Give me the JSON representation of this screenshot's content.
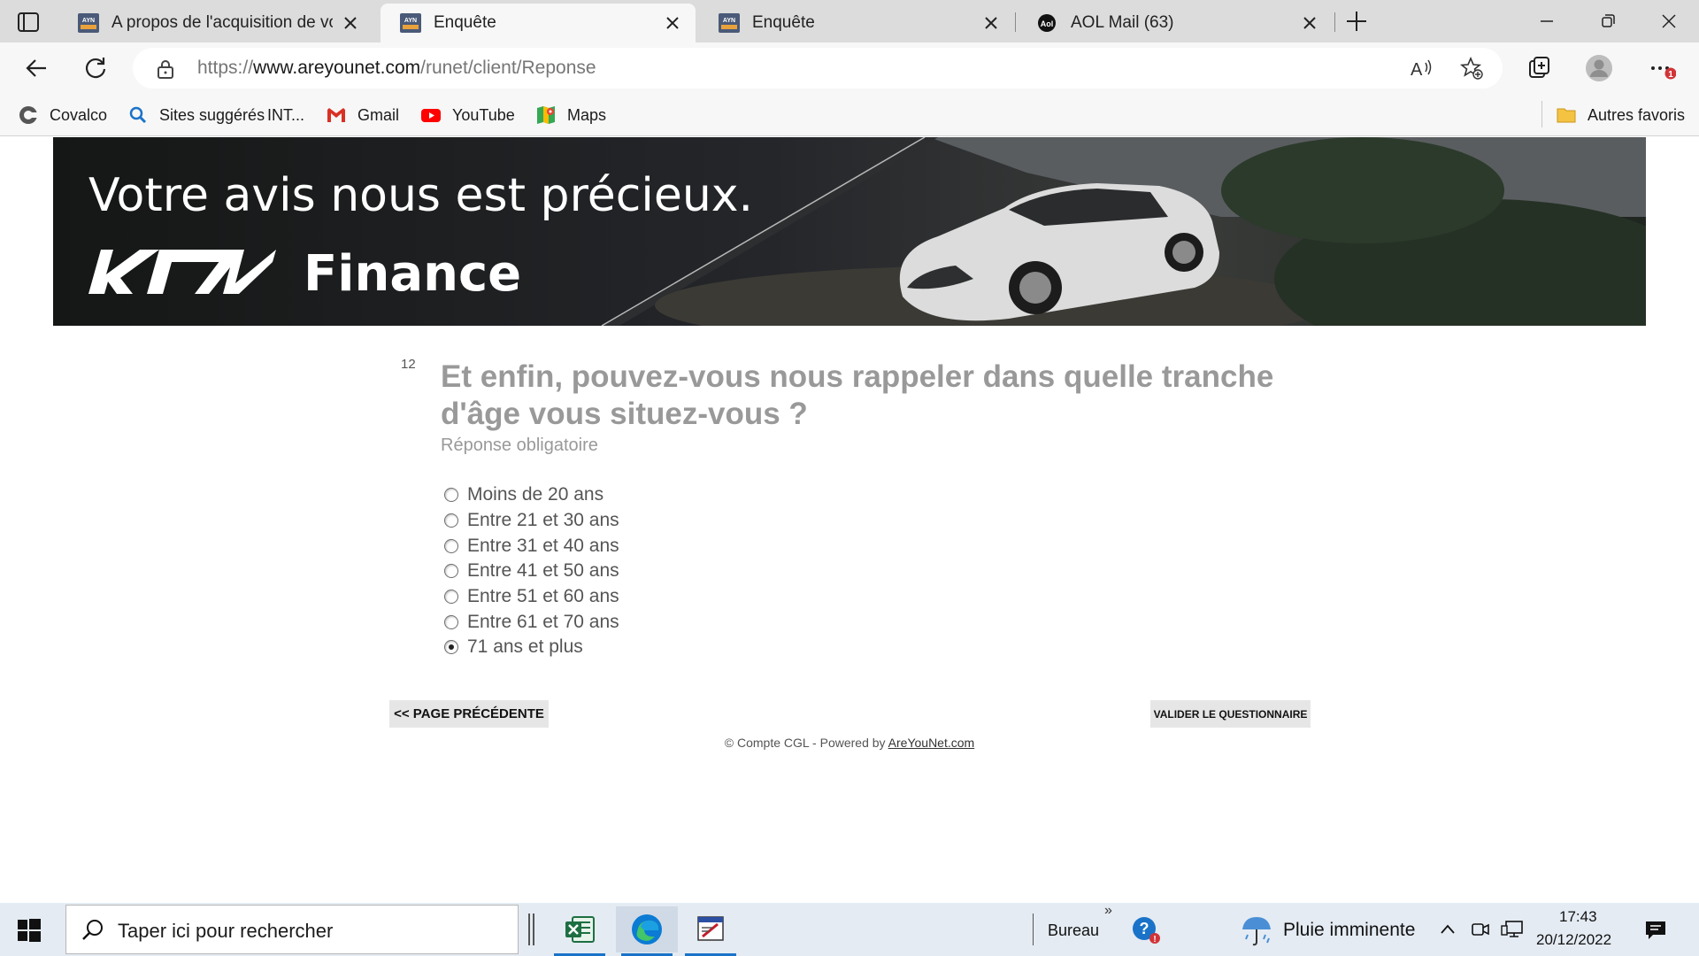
{
  "browser": {
    "tabs": [
      {
        "title": "A propos de l'acquisition de votr",
        "favicon": "ayn-icon",
        "active": false
      },
      {
        "title": "Enquête",
        "favicon": "ayn-icon",
        "active": true
      },
      {
        "title": "Enquête",
        "favicon": "ayn-icon",
        "active": false
      },
      {
        "title": "AOL Mail (63)",
        "favicon": "aol-icon",
        "active": false
      }
    ],
    "url_scheme": "https://",
    "url_host": "www.areyounet.com",
    "url_path": "/runet/client/Reponse",
    "notification_count": "1",
    "bookmarks": [
      {
        "label": "Covalco",
        "icon": "covalco-icon"
      },
      {
        "label": "Sites suggérés",
        "icon": "search-icon"
      },
      {
        "label": "INT...",
        "icon": ""
      },
      {
        "label": "Gmail",
        "icon": "gmail-icon"
      },
      {
        "label": "YouTube",
        "icon": "youtube-icon"
      },
      {
        "label": "Maps",
        "icon": "maps-icon"
      }
    ],
    "other_favorites": "Autres favoris"
  },
  "banner": {
    "headline": "Votre avis nous est précieux.",
    "brand": "Finance"
  },
  "survey": {
    "question_number": "12",
    "question": "Et enfin, pouvez-vous nous rappeler dans quelle tranche d'âge vous situez-vous ?",
    "required_note": "Réponse obligatoire",
    "options": [
      {
        "label": "Moins de 20 ans",
        "selected": false
      },
      {
        "label": "Entre 21 et 30 ans",
        "selected": false
      },
      {
        "label": "Entre 31 et 40 ans",
        "selected": false
      },
      {
        "label": "Entre 41 et 50 ans",
        "selected": false
      },
      {
        "label": "Entre 51 et 60 ans",
        "selected": false
      },
      {
        "label": "Entre 61 et 70 ans",
        "selected": false
      },
      {
        "label": "71 ans et plus",
        "selected": true
      }
    ],
    "prev_button": "<< PAGE PRÉCÉDENTE",
    "submit_button": "VALIDER LE QUESTIONNAIRE",
    "footer_text": "© Compte CGL - Powered by ",
    "footer_link": "AreYouNet.com"
  },
  "taskbar": {
    "search_placeholder": "Taper ici pour rechercher",
    "toolbar_label": "Bureau",
    "weather": "Pluie imminente",
    "time": "17:43",
    "date": "20/12/2022"
  },
  "colors": {
    "question_text": "#999999",
    "accent": "#1a73c8",
    "notification": "#d13438"
  }
}
